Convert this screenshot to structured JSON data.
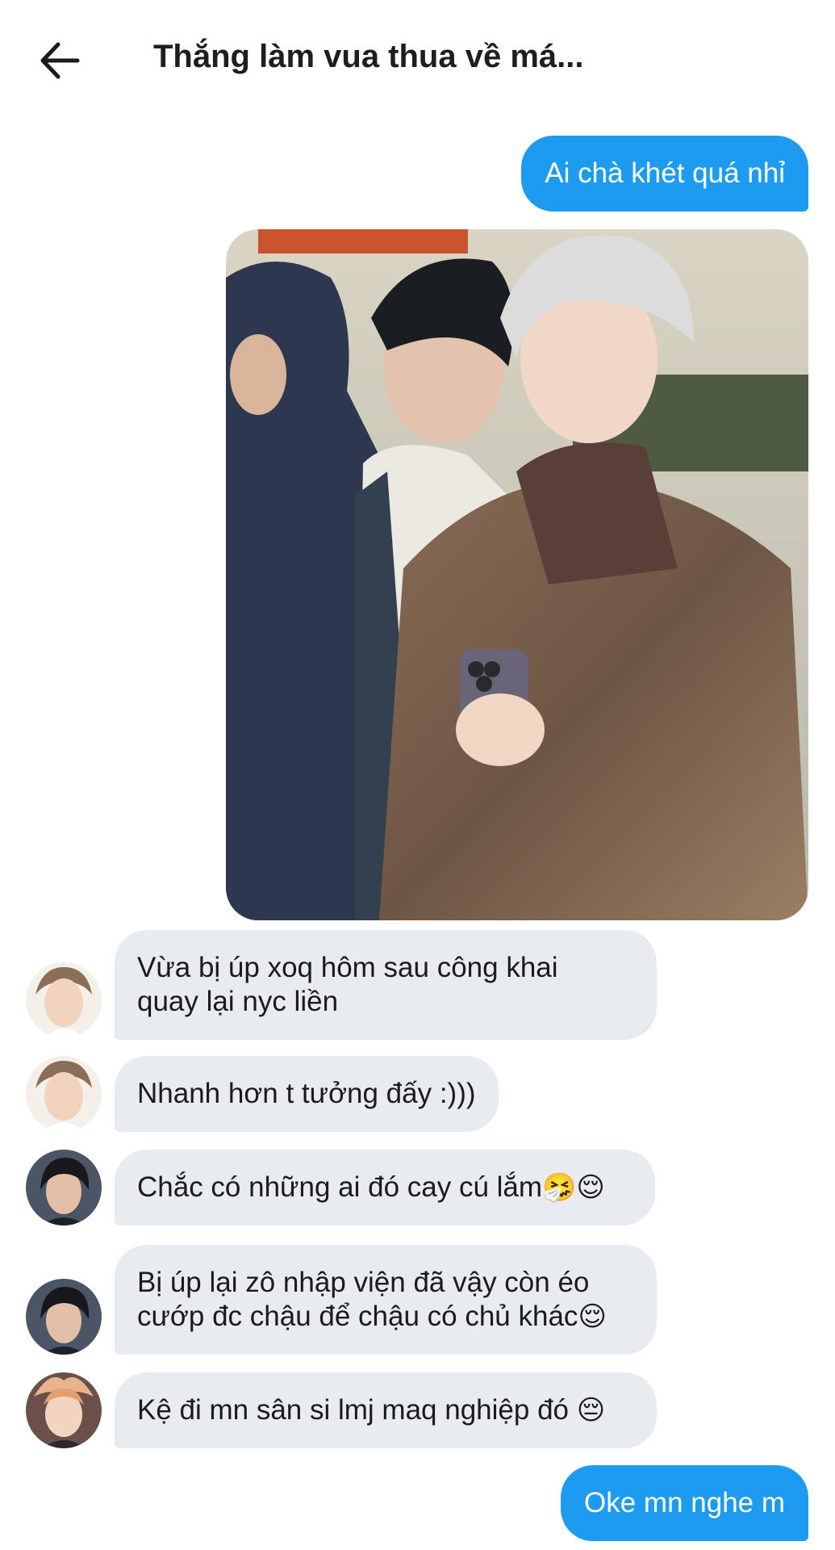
{
  "header": {
    "title": "Thắng làm vua thua về má...",
    "back_icon": "arrow-left-icon"
  },
  "messages": [
    {
      "direction": "outgoing",
      "text": "Ai chà khét quá nhỉ"
    },
    {
      "direction": "outgoing",
      "type": "photo",
      "description_icon": "photo-image"
    },
    {
      "direction": "incoming",
      "lines": [
        "Vừa bị úp xoq hôm sau công khai",
        "quay lại nyc liền"
      ]
    },
    {
      "direction": "incoming",
      "text": "Nhanh hơn t tưởng đấy :)))"
    },
    {
      "direction": "incoming",
      "text": "Chắc có những ai đó cay cú lắm",
      "emoji": "🤧😌"
    },
    {
      "direction": "incoming",
      "lines": [
        "Bị úp lại zô nhập viện đã vậy còn éo",
        "cướp đc chậu để chậu có chủ khác"
      ],
      "emoji": "😌"
    },
    {
      "direction": "incoming",
      "text": "Kệ đi mn sân si lmj maq nghiệp đó",
      "emoji": "😔"
    },
    {
      "direction": "outgoing",
      "text": "Oke mn nghe m"
    }
  ],
  "colors": {
    "outgoing_bubble": "#1d9bf0",
    "incoming_bubble": "#e8ebef",
    "background": "#ffffff"
  }
}
